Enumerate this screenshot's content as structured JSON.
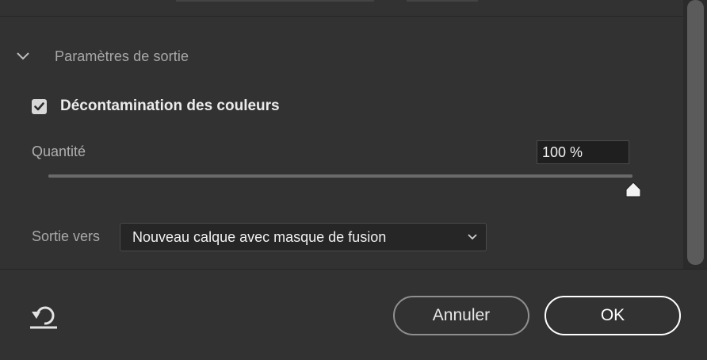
{
  "section": {
    "title": "Paramètres de sortie",
    "expanded": true,
    "chevron_icon": "chevron-down-icon"
  },
  "decontamination": {
    "label": "Décontamination des couleurs",
    "checked": true,
    "check_icon": "checkmark-icon"
  },
  "amount": {
    "label": "Quantité",
    "value": "100 %",
    "level": 1.0
  },
  "output": {
    "label": "Sortie vers",
    "selected": "Nouveau calque avec masque de fusion",
    "chevron_icon": "chevron-down-icon"
  },
  "footer": {
    "reset_icon": "reset-icon",
    "cancel_label": "Annuler",
    "ok_label": "OK"
  },
  "colors": {
    "background": "#323232",
    "input_bg": "#1f1f1f",
    "text_primary": "#ececec",
    "text_secondary": "#a8a8a8"
  }
}
